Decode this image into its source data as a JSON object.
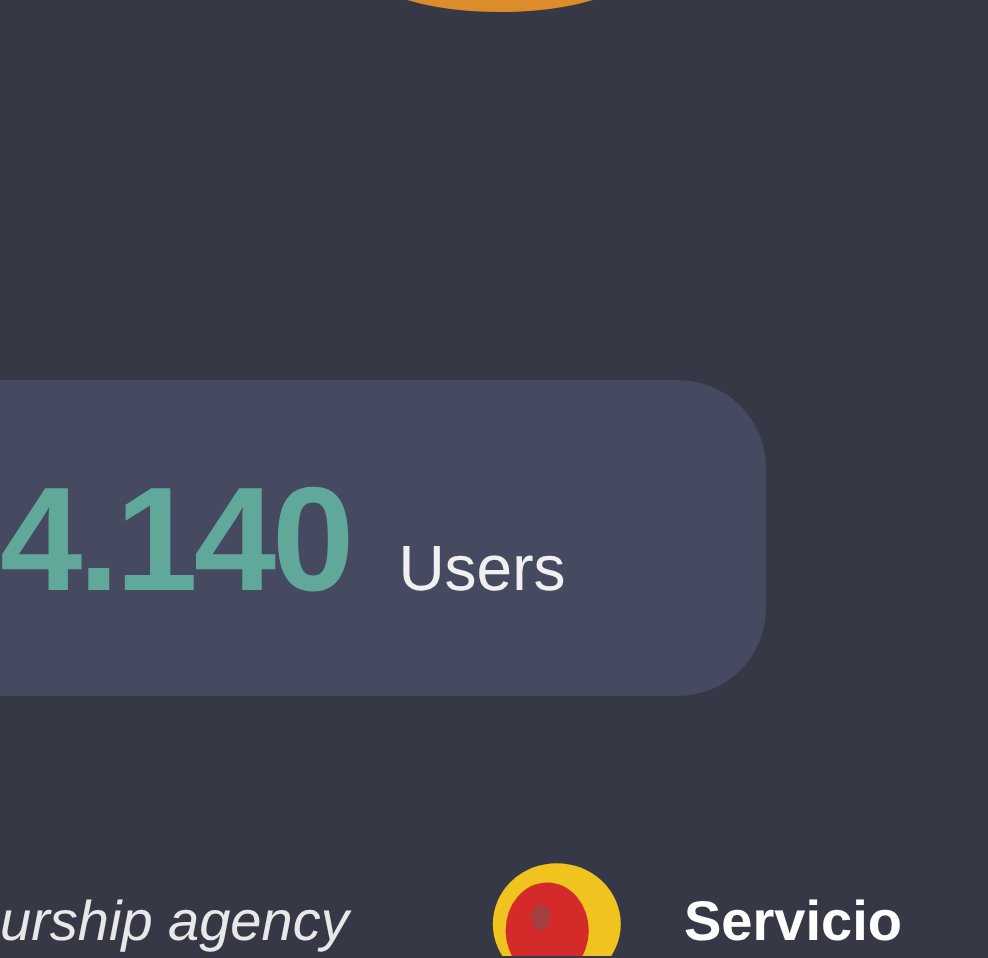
{
  "stat_card": {
    "value": "4.140",
    "unit": "Users"
  },
  "footer": {
    "tagline": "urship agency",
    "brand": "Servicio"
  }
}
